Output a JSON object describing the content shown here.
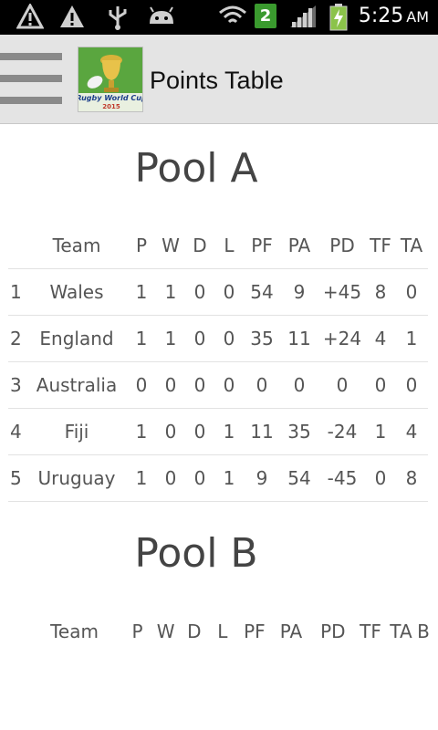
{
  "status_bar": {
    "notification_icons": [
      "warning-icon",
      "warning-icon",
      "usb-icon",
      "android-icon"
    ],
    "badge": "2",
    "time": "5:25",
    "ampm": "AM",
    "system_icons": [
      "wifi-icon",
      "signal-icon",
      "battery-charging-icon"
    ]
  },
  "action_bar": {
    "menu_icon": "hamburger-icon",
    "logo": {
      "line1": "Rugby World Cup",
      "line2": "2015"
    },
    "title": "Points Table"
  },
  "table_headers": [
    "",
    "Team",
    "P",
    "W",
    "D",
    "L",
    "PF",
    "PA",
    "PD",
    "TF",
    "TA"
  ],
  "pools": [
    {
      "title": "Pool A",
      "rows": [
        [
          "1",
          "Wales",
          "1",
          "1",
          "0",
          "0",
          "54",
          "9",
          "+45",
          "8",
          "0"
        ],
        [
          "2",
          "England",
          "1",
          "1",
          "0",
          "0",
          "35",
          "11",
          "+24",
          "4",
          "1"
        ],
        [
          "3",
          "Australia",
          "0",
          "0",
          "0",
          "0",
          "0",
          "0",
          "0",
          "0",
          "0"
        ],
        [
          "4",
          "Fiji",
          "1",
          "0",
          "0",
          "1",
          "11",
          "35",
          "-24",
          "1",
          "4"
        ],
        [
          "5",
          "Uruguay",
          "1",
          "0",
          "0",
          "1",
          "9",
          "54",
          "-45",
          "0",
          "8"
        ]
      ]
    },
    {
      "title": "Pool B",
      "headers_extra": "B"
    }
  ]
}
